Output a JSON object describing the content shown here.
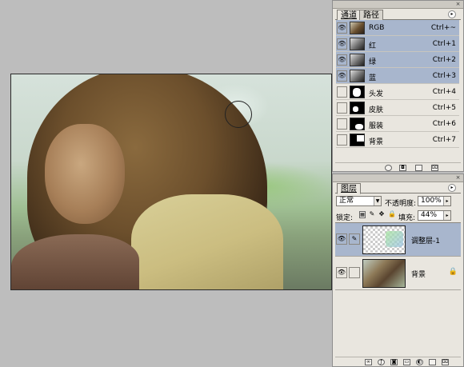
{
  "channels_panel": {
    "tabs": [
      "通道",
      "路径"
    ],
    "channels": [
      {
        "name": "RGB",
        "shortcut": "Ctrl+~",
        "selected": true,
        "visible": true
      },
      {
        "name": "红",
        "shortcut": "Ctrl+1",
        "selected": true,
        "visible": true
      },
      {
        "name": "绿",
        "shortcut": "Ctrl+2",
        "selected": true,
        "visible": true
      },
      {
        "name": "蓝",
        "shortcut": "Ctrl+3",
        "selected": true,
        "visible": true
      },
      {
        "name": "头发",
        "shortcut": "Ctrl+4",
        "selected": false,
        "visible": false
      },
      {
        "name": "皮肤",
        "shortcut": "Ctrl+5",
        "selected": false,
        "visible": false
      },
      {
        "name": "服装",
        "shortcut": "Ctrl+6",
        "selected": false,
        "visible": false
      },
      {
        "name": "背景",
        "shortcut": "Ctrl+7",
        "selected": false,
        "visible": false
      }
    ]
  },
  "layers_panel": {
    "tab": "图层",
    "blend_mode": "正常",
    "opacity_label": "不透明度:",
    "opacity_value": "100%",
    "lock_label": "锁定:",
    "fill_label": "填充:",
    "fill_value": "44%",
    "layers": [
      {
        "name": "调整层-1",
        "selected": true
      },
      {
        "name": "背景",
        "selected": false
      }
    ]
  },
  "colors": {
    "selection": "#a8b6cd",
    "panel_bg": "#e9e6df",
    "workspace_bg": "#bdbdbd"
  }
}
